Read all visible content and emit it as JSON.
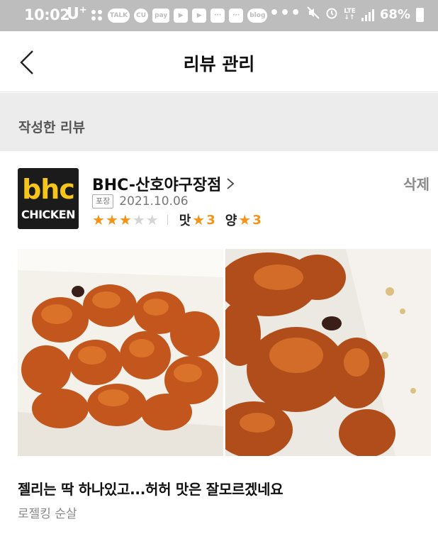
{
  "status_bar": {
    "time": "10:02",
    "carrier": "U",
    "carrier_sup": "+",
    "app_icons": [
      "TALK",
      "CU",
      "pay",
      "▶",
      "▶",
      "···",
      "···",
      "blog"
    ],
    "battery": "68%"
  },
  "header": {
    "title": "리뷰 관리"
  },
  "section": {
    "title": "작성한 리뷰"
  },
  "review": {
    "logo": {
      "top": "bhc",
      "bottom": "CHICKEN"
    },
    "store_name": "BHC-산호야구장점",
    "order_type": "포장",
    "date": "2021.10.06",
    "overall_rating": 3,
    "max_rating": 5,
    "sub_ratings": [
      {
        "label": "맛",
        "value": "3"
      },
      {
        "label": "양",
        "value": "3"
      }
    ],
    "delete_label": "삭제",
    "text": "젤리는 딱 하나있고...허허 맛은 잘모르겠네요",
    "menu": "로젤킹 순살"
  },
  "colors": {
    "accent": "#f39419",
    "logo_yellow": "#f6c51a",
    "section_bg": "#ececec",
    "status_bar_bg": "#bdbdbd"
  }
}
